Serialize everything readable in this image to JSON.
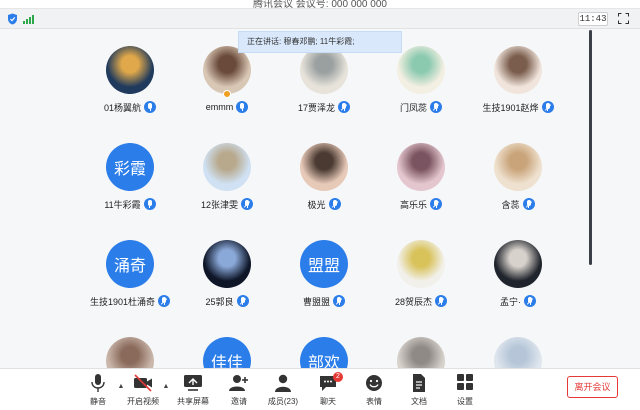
{
  "window": {
    "title": "腾讯会议 会议号: 000 000 000"
  },
  "topbar": {
    "time": "11:43"
  },
  "speaking": {
    "text": "正在讲话: 穆春邓鹏; 11牛彩霞;"
  },
  "participants": [
    {
      "name": "01杨翼航",
      "avatar": "photo",
      "tone": "#1f3a5c",
      "accent": "#e0a84a",
      "mic": "on"
    },
    {
      "name": "emmm",
      "avatar": "photo",
      "tone": "#d9c7b5",
      "accent": "#6a4a3a",
      "mic": "on",
      "badge": true
    },
    {
      "name": "17贾泽龙",
      "avatar": "photo",
      "tone": "#e7e3da",
      "accent": "#9aa0a0",
      "mic": "muted"
    },
    {
      "name": "门凤蕊",
      "avatar": "photo",
      "tone": "#f3efe2",
      "accent": "#8ccab0",
      "mic": "muted"
    },
    {
      "name": "生技1901赵烨",
      "avatar": "photo",
      "tone": "#f0e4dc",
      "accent": "#7a5d4c",
      "mic": "muted"
    },
    {
      "name": "11牛彩霞",
      "avatar": "text",
      "text": "彩霞",
      "mic": "on"
    },
    {
      "name": "12张津雯",
      "avatar": "photo",
      "tone": "#cfe1f2",
      "accent": "#b8a88c",
      "mic": "muted"
    },
    {
      "name": "极光",
      "avatar": "photo",
      "tone": "#e7c9b8",
      "accent": "#4a3a32",
      "mic": "muted"
    },
    {
      "name": "高乐乐",
      "avatar": "photo",
      "tone": "#e4c6cf",
      "accent": "#7a5460",
      "mic": "muted"
    },
    {
      "name": "含蕊",
      "avatar": "photo",
      "tone": "#efe1cf",
      "accent": "#c9a47a",
      "mic": "muted"
    },
    {
      "name": "生技1901杜涌奇",
      "avatar": "text",
      "text": "涌奇",
      "mic": "muted"
    },
    {
      "name": "25郭良",
      "avatar": "photo",
      "tone": "#0e1628",
      "accent": "#8aa8d8",
      "mic": "muted"
    },
    {
      "name": "曹盟盟",
      "avatar": "text",
      "text": "盟盟",
      "mic": "muted"
    },
    {
      "name": "28贺辰杰",
      "avatar": "photo",
      "tone": "#f2f0ea",
      "accent": "#d8c25a",
      "mic": "muted"
    },
    {
      "name": "孟宁·",
      "avatar": "photo",
      "tone": "#20242c",
      "accent": "#d8d2cc",
      "mic": "muted"
    },
    {
      "name": "",
      "avatar": "photo",
      "tone": "#cbb8ad",
      "accent": "#8a6a5a",
      "mic": "none"
    },
    {
      "name": "",
      "avatar": "text",
      "text": "佳佳",
      "mic": "none"
    },
    {
      "name": "",
      "avatar": "text",
      "text": "部欢",
      "mic": "none"
    },
    {
      "name": "",
      "avatar": "photo",
      "tone": "#d7d2cc",
      "accent": "#8f8a86",
      "mic": "none"
    },
    {
      "name": "",
      "avatar": "photo",
      "tone": "#dfe6ee",
      "accent": "#b6c6d8",
      "mic": "none"
    }
  ],
  "toolbar": {
    "mute": "静音",
    "video": "开启视频",
    "share": "共享屏幕",
    "invite": "邀请",
    "members": "成员(23)",
    "chat": "聊天",
    "chat_count": "2",
    "reaction": "表情",
    "docs": "文档",
    "settings": "设置",
    "leave": "离开会议"
  },
  "colors": {
    "accent": "#2b7de9",
    "danger": "#e53935"
  }
}
